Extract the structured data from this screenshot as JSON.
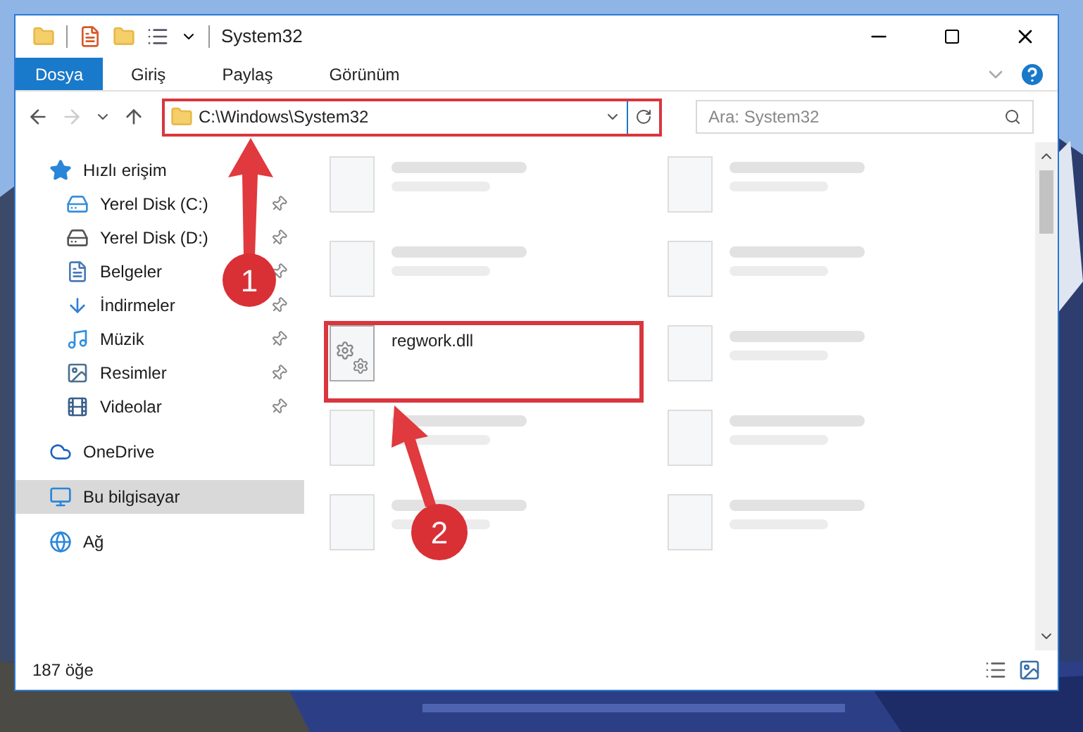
{
  "window": {
    "title": "System32"
  },
  "ribbon_tabs": [
    {
      "label": "Dosya",
      "selected": true
    },
    {
      "label": "Giriş",
      "selected": false
    },
    {
      "label": "Paylaş",
      "selected": false
    },
    {
      "label": "Görünüm",
      "selected": false
    }
  ],
  "address_bar": {
    "path": "C:\\Windows\\System32"
  },
  "search": {
    "placeholder": "Ara: System32"
  },
  "sidebar": {
    "quick_access": {
      "label": "Hızlı erişim",
      "children": [
        {
          "label": "Yerel Disk (C:)",
          "kind": "drive-c",
          "pinned": true
        },
        {
          "label": "Yerel Disk (D:)",
          "kind": "drive",
          "pinned": true
        },
        {
          "label": "Belgeler",
          "kind": "docs",
          "pinned": true
        },
        {
          "label": "İndirmeler",
          "kind": "downloads",
          "pinned": true
        },
        {
          "label": "Müzik",
          "kind": "music",
          "pinned": true
        },
        {
          "label": "Resimler",
          "kind": "pictures",
          "pinned": true
        },
        {
          "label": "Videolar",
          "kind": "videos",
          "pinned": true
        }
      ]
    },
    "items": [
      {
        "label": "OneDrive",
        "kind": "cloud",
        "selected": false
      },
      {
        "label": "Bu bilgisayar",
        "kind": "pc",
        "selected": true
      },
      {
        "label": "Ağ",
        "kind": "network",
        "selected": false
      }
    ]
  },
  "files": [
    {
      "kind": "blurred"
    },
    {
      "kind": "blurred"
    },
    {
      "kind": "blurred"
    },
    {
      "kind": "blurred"
    },
    {
      "kind": "file",
      "name": "regwork.dll"
    },
    {
      "kind": "blurred"
    },
    {
      "kind": "blurred"
    },
    {
      "kind": "blurred"
    },
    {
      "kind": "blurred"
    },
    {
      "kind": "blurred"
    }
  ],
  "status_bar": {
    "count": "187 öğe"
  },
  "annotations": [
    {
      "label": "1"
    },
    {
      "label": "2"
    }
  ]
}
